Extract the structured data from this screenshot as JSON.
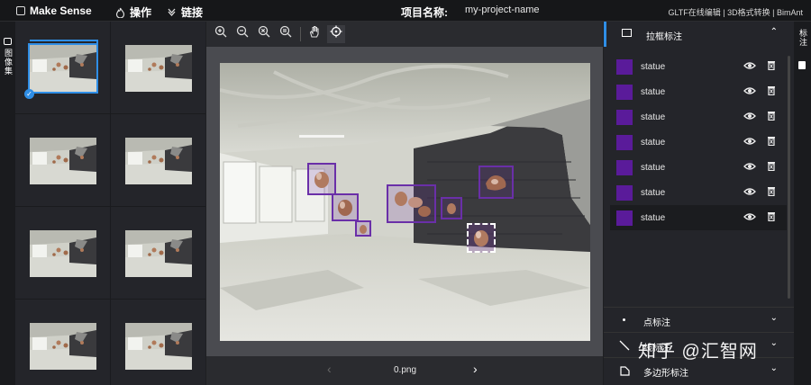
{
  "header": {
    "brand": "Make Sense",
    "menu": [
      {
        "label": "操作",
        "icon": "flame-icon"
      },
      {
        "label": "链接",
        "icon": "link-icon"
      }
    ],
    "project_label": "项目名称:",
    "project_name": "my-project-name",
    "links_text": "GLTF在线编辑 | 3D格式转换 | BimAnt"
  },
  "left_panel": {
    "tab_label": "图像集",
    "thumbnails": [
      "image-1",
      "image-2",
      "image-3",
      "image-4",
      "image-5",
      "image-6",
      "image-7",
      "image-8"
    ],
    "active_index": 0
  },
  "toolbar": {
    "tools": [
      "zoom-in-icon",
      "zoom-out-icon",
      "zoom-fit-icon",
      "zoom-max-icon",
      "hand-icon",
      "crosshair-icon"
    ],
    "active": "crosshair-icon"
  },
  "navigation": {
    "filename": "0.png",
    "prev_symbol": "‹",
    "next_symbol": "›"
  },
  "right_panel": {
    "tab_label": "标注",
    "sections": [
      {
        "label": "拉框标注",
        "expanded": true,
        "icon": "rect-icon"
      },
      {
        "label": "点标注",
        "expanded": false,
        "icon": "point-icon"
      },
      {
        "label": "线标注",
        "expanded": false,
        "icon": "line-icon"
      },
      {
        "label": "多边形标注",
        "expanded": false,
        "icon": "polygon-icon"
      }
    ],
    "labels": [
      "statue",
      "statue",
      "statue",
      "statue",
      "statue",
      "statue",
      "statue"
    ],
    "label_color": "#5a1b9a"
  },
  "watermark": "知乎 @汇智网",
  "colors": {
    "accent": "#2f8ee6",
    "box": "#6a2fa8"
  }
}
